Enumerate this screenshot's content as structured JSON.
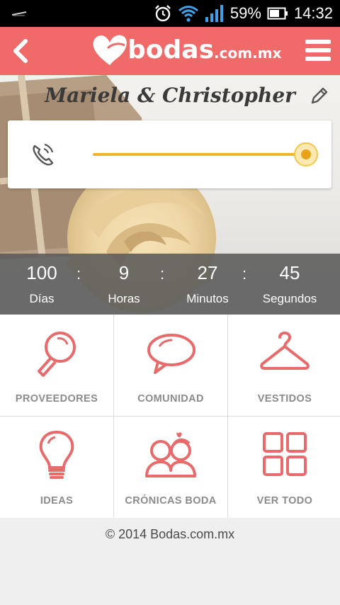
{
  "status_bar": {
    "battery": "59%",
    "time": "14:32"
  },
  "app_bar": {
    "logo_text": "bodas",
    "logo_suffix": ".com.mx"
  },
  "hero": {
    "couple": "Mariela & Christopher",
    "slider_fraction": 1.0
  },
  "countdown": {
    "days": {
      "value": "100",
      "label": "Días"
    },
    "hours": {
      "value": "9",
      "label": "Horas"
    },
    "minutes": {
      "value": "27",
      "label": "Minutos"
    },
    "seconds": {
      "value": "45",
      "label": "Segundos"
    },
    "separator": ":"
  },
  "grid": {
    "tiles": [
      {
        "label": "PROVEEDORES",
        "icon": "magnifier-icon"
      },
      {
        "label": "COMUNIDAD",
        "icon": "speech-bubble-icon"
      },
      {
        "label": "VESTIDOS",
        "icon": "hanger-icon"
      },
      {
        "label": "IDEAS",
        "icon": "lightbulb-icon"
      },
      {
        "label": "CRÓNICAS BODA",
        "icon": "couple-icon"
      },
      {
        "label": "VER TODO",
        "icon": "grid-icon"
      }
    ]
  },
  "colors": {
    "brand": "#f06a6a",
    "icon_stroke": "#e86a6a",
    "slider": "#f0b429"
  },
  "footer": "© 2014 Bodas.com.mx"
}
